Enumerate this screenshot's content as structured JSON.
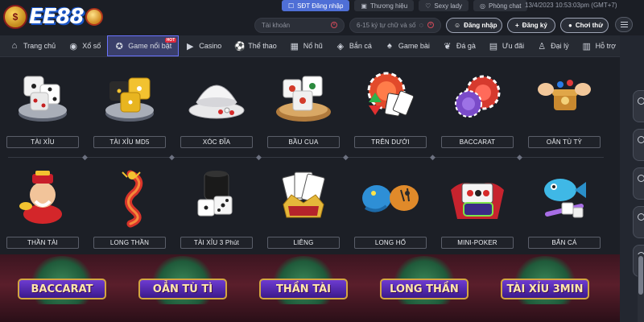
{
  "brand": {
    "logo_text": "EE88"
  },
  "header": {
    "top_links": [
      {
        "label": "SĐT Đăng nhập",
        "icon": "phone-icon",
        "active": true
      },
      {
        "label": "Thương hiệu",
        "icon": "brand-icon",
        "active": false
      },
      {
        "label": "Sexy lady",
        "icon": "heart-icon",
        "active": false
      },
      {
        "label": "Phòng chat",
        "icon": "chat-icon",
        "active": false
      }
    ],
    "datetime": "13/4/2023 10:53:03pm (GMT+7)",
    "username_placeholder": "Tài khoản",
    "password_placeholder": "6-15 ký tự chữ và số",
    "login_label": "Đăng nhập",
    "register_label": "Đăng ký",
    "trial_label": "Chơi thử"
  },
  "nav": {
    "items": [
      {
        "label": "Trang chủ",
        "icon": "home-icon"
      },
      {
        "label": "Xổ số",
        "icon": "lottery-icon"
      },
      {
        "label": "Game nổi bật",
        "icon": "featured-game-icon",
        "active": true,
        "badge": "HOT"
      },
      {
        "label": "Casino",
        "icon": "casino-icon"
      },
      {
        "label": "Thể thao",
        "icon": "sports-icon"
      },
      {
        "label": "Nổ hũ",
        "icon": "slots-icon"
      },
      {
        "label": "Bắn cá",
        "icon": "fish-icon"
      },
      {
        "label": "Game bài",
        "icon": "cards-icon"
      },
      {
        "label": "Đá gà",
        "icon": "rooster-icon"
      },
      {
        "label": "Ưu đãi",
        "icon": "gift-icon"
      },
      {
        "label": "Đại lý",
        "icon": "agent-icon"
      },
      {
        "label": "Hỗ trợ",
        "icon": "support-icon"
      }
    ]
  },
  "games": {
    "row1": [
      {
        "label": "TÀI XỈU",
        "icon": "dice-icon"
      },
      {
        "label": "TÀI XỈU MD5",
        "icon": "gold-dice-icon"
      },
      {
        "label": "XÓC ĐĨA",
        "icon": "bowl-plate-icon"
      },
      {
        "label": "BẦU CUA",
        "icon": "crab-dice-icon"
      },
      {
        "label": "TRÊN DƯỚI",
        "icon": "poker-chips-icon"
      },
      {
        "label": "BACCARAT",
        "icon": "casino-chips-icon"
      },
      {
        "label": "OẲN TÙ TỲ",
        "icon": "rock-paper-scissors-icon"
      }
    ],
    "row2": [
      {
        "label": "THẦN TÀI",
        "icon": "god-of-wealth-icon"
      },
      {
        "label": "LONG THẦN",
        "icon": "dragon-icon"
      },
      {
        "label": "TÀI XỈU 3 Phút",
        "icon": "dice-cup-icon"
      },
      {
        "label": "LIÊNG",
        "icon": "crown-cards-icon"
      },
      {
        "label": "LONG HỔ",
        "icon": "dragon-tiger-icon"
      },
      {
        "label": "MINI-POKER",
        "icon": "wild-slot-icon"
      },
      {
        "label": "BẮN CÁ",
        "icon": "fish-shooter-icon"
      }
    ]
  },
  "banner": {
    "titles": [
      "BACCARAT",
      "OẲN TÙ TÌ",
      "THẦN TÀI",
      "LONG THẦN",
      "TÀI XỈU 3MIN"
    ]
  },
  "colors": {
    "accent": "#4f6fd6",
    "nav_active": "#3a3f6a",
    "panel_bg": "#1c1f26",
    "header_bg": "#1b1e25"
  }
}
